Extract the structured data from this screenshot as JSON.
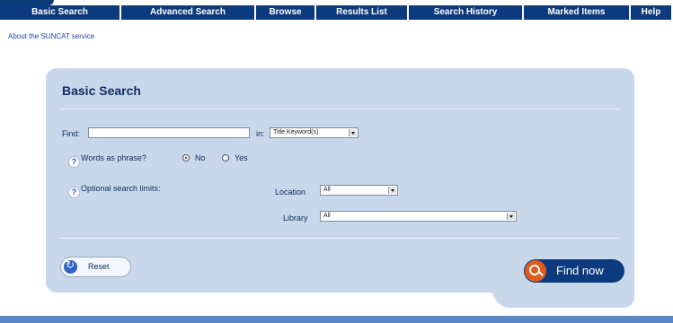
{
  "nav": {
    "items": [
      {
        "label": "Basic Search"
      },
      {
        "label": "Advanced Search"
      },
      {
        "label": "Browse"
      },
      {
        "label": "Results List"
      },
      {
        "label": "Search History"
      },
      {
        "label": "Marked Items"
      },
      {
        "label": "Help"
      }
    ]
  },
  "about_link": "About the SUNCAT service",
  "panel": {
    "title": "Basic Search",
    "find_label": "Find:",
    "find_value": "",
    "in_label": "in:",
    "in_select": "Title Keyword(s)",
    "help_icon": "?",
    "phrase_label": "Words as phrase?",
    "phrase_no": "No",
    "phrase_yes": "Yes",
    "phrase_selected": "No",
    "limits_label": "Optional search limits:",
    "location_label": "Location",
    "location_value": "All",
    "library_label": "Library",
    "library_value": "All",
    "reset_label": "Reset",
    "find_button_label": "Find now"
  },
  "colors": {
    "nav_bg": "#0b3a7e",
    "panel_bg": "#c9d7ea",
    "find_button_bg": "#0b3a7e",
    "find_icon_bg": "#e15a1d"
  },
  "icons": [
    "reset-icon",
    "search-icon",
    "help-icon"
  ]
}
